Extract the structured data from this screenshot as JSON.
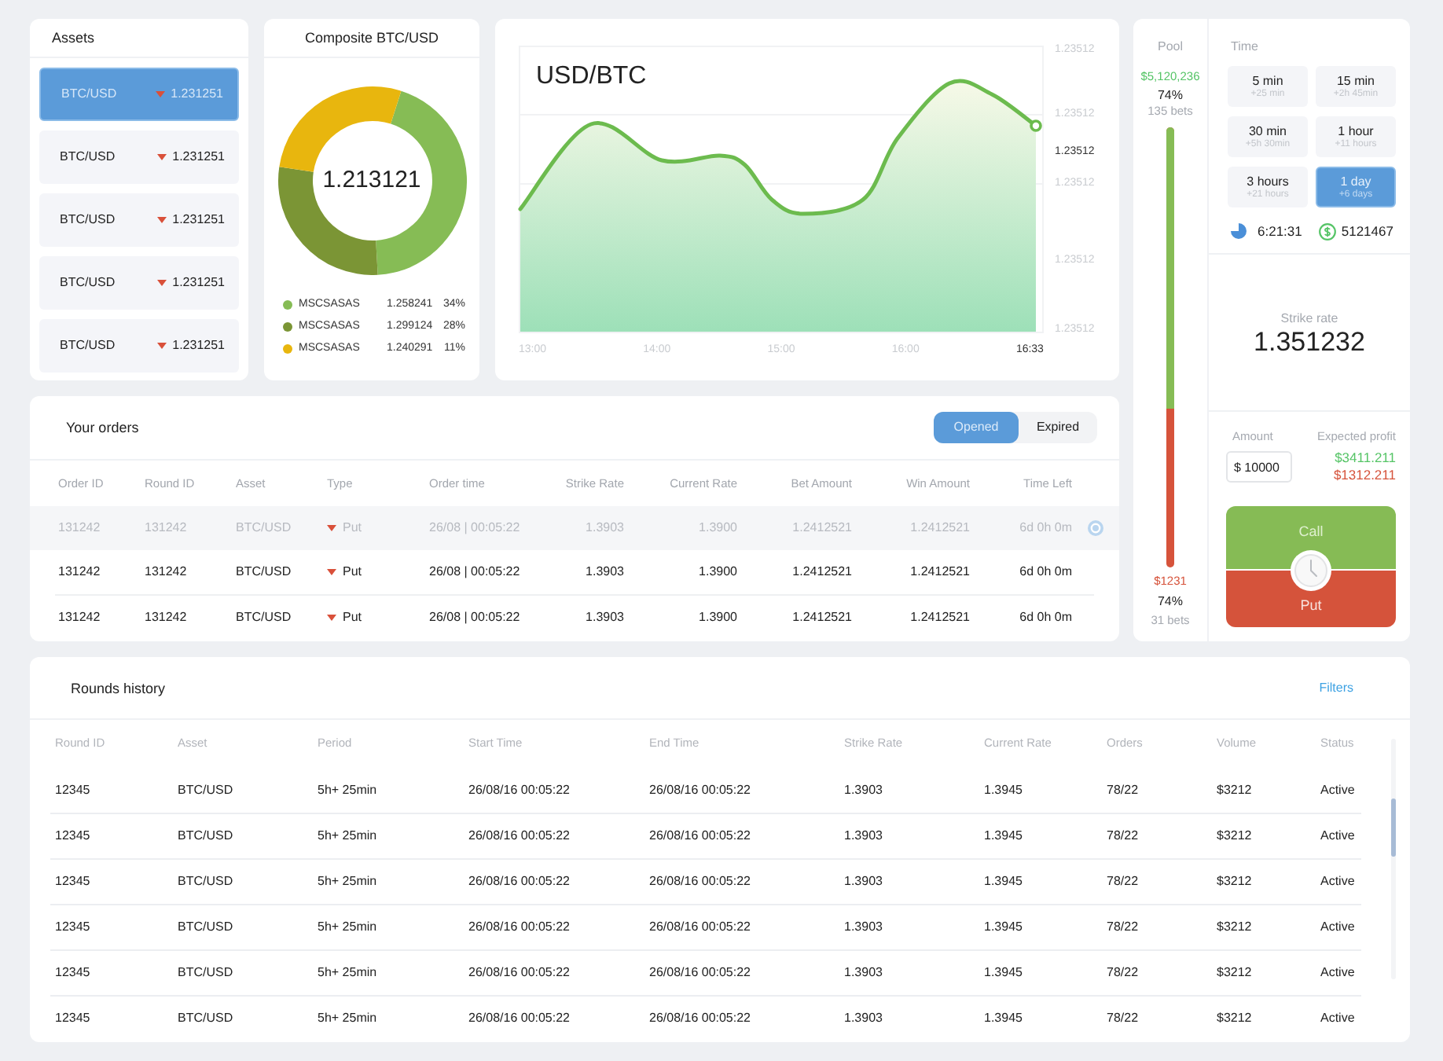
{
  "assets": {
    "title": "Assets",
    "items": [
      {
        "pair": "BTC/USD",
        "falling": true,
        "price": "1.231251",
        "selected": true
      },
      {
        "pair": "BTC/USD",
        "falling": true,
        "price": "1.231251",
        "selected": false
      },
      {
        "pair": "BTC/USD",
        "falling": true,
        "price": "1.231251",
        "selected": false
      },
      {
        "pair": "BTC/USD",
        "falling": true,
        "price": "1.231251",
        "selected": false
      },
      {
        "pair": "BTC/USD",
        "falling": true,
        "price": "1.231251",
        "selected": false
      }
    ]
  },
  "composite": {
    "title": "Composite BTC/USD",
    "center_value": "1.213121",
    "legend": [
      {
        "name": "MSCSASAS",
        "value": "1.258241",
        "share": "34%",
        "color": "#86bc55"
      },
      {
        "name": "MSCSASAS",
        "value": "1.299124",
        "share": "28%",
        "color": "#7b9535"
      },
      {
        "name": "MSCSASAS",
        "value": "1.240291",
        "share": "11%",
        "color": "#e8b60e"
      }
    ]
  },
  "price_chart": {
    "title": "USD/BTC",
    "y_labels": [
      {
        "text": "1.23512",
        "current": false
      },
      {
        "text": "1.23512",
        "current": false
      },
      {
        "text": "1.23512",
        "current": true
      },
      {
        "text": "1.23512",
        "current": false
      },
      {
        "text": "1.23512",
        "current": false
      },
      {
        "text": "1.23512",
        "current": false
      }
    ],
    "x_labels": [
      {
        "text": "13:00",
        "current": false
      },
      {
        "text": "14:00",
        "current": false
      },
      {
        "text": "15:00",
        "current": false
      },
      {
        "text": "16:00",
        "current": false
      },
      {
        "text": "16:33",
        "current": true
      }
    ]
  },
  "orders": {
    "title": "Your orders",
    "filters": [
      {
        "label": "Opened",
        "selected": true
      },
      {
        "label": "Expired",
        "selected": false
      }
    ],
    "columns": [
      "Order ID",
      "Round ID",
      "Asset",
      "Type",
      "Order time",
      "Strike Rate",
      "Current Rate",
      "Bet Amount",
      "Win Amount",
      "Time Left"
    ],
    "rows": [
      {
        "pending": true,
        "falling": true,
        "cells": [
          "131242",
          "131242",
          "BTC/USD",
          "Put",
          "26/08 | 00:05:22",
          "1.3903",
          "1.3900",
          "1.2412521",
          "1.2412521",
          "6d 0h 0m"
        ]
      },
      {
        "pending": false,
        "falling": true,
        "cells": [
          "131242",
          "131242",
          "BTC/USD",
          "Put",
          "26/08 | 00:05:22",
          "1.3903",
          "1.3900",
          "1.2412521",
          "1.2412521",
          "6d 0h 0m"
        ]
      },
      {
        "pending": false,
        "falling": true,
        "cells": [
          "131242",
          "131242",
          "BTC/USD",
          "Put",
          "26/08 | 00:05:22",
          "1.3903",
          "1.3900",
          "1.2412521",
          "1.2412521",
          "6d 0h 0m"
        ]
      }
    ]
  },
  "pool": {
    "title": "Pool",
    "call": {
      "amount": "$5,120,236",
      "share": "74%",
      "bets": "135 bets"
    },
    "put": {
      "amount": "$1231",
      "share": "74%",
      "bets": "31 bets"
    },
    "level": 0.64
  },
  "time": {
    "title": "Time",
    "options": [
      {
        "label": "5 min",
        "sub": "+25 min",
        "selected": false
      },
      {
        "label": "15 min",
        "sub": "+2h 45min",
        "selected": false
      },
      {
        "label": "30 min",
        "sub": "+5h 30min",
        "selected": false
      },
      {
        "label": "1 hour",
        "sub": "+11 hours",
        "selected": false
      },
      {
        "label": "3 hours",
        "sub": "+21 hours",
        "selected": false
      },
      {
        "label": "1 day",
        "sub": "+6 days",
        "selected": true
      }
    ],
    "countdown": "6:21:31",
    "count": "5121467"
  },
  "strike": {
    "label": "Strike rate",
    "value": "1.351232"
  },
  "trade": {
    "amount_label": "Amount",
    "amount": "$ 10000",
    "profit_label": "Expected profit",
    "profit_call": "$3411.211",
    "profit_put": "$1312.211",
    "call_label": "Call",
    "put_label": "Put"
  },
  "rounds": {
    "title": "Rounds history",
    "filters_label": "Filters",
    "columns": [
      "Round ID",
      "Asset",
      "Period",
      "Start Time",
      "End Time",
      "Strike Rate",
      "Current Rate",
      "Orders",
      "Volume",
      "Status"
    ],
    "rows": [
      [
        "12345",
        "BTC/USD",
        "5h+ 25min",
        "26/08/16 00:05:22",
        "26/08/16 00:05:22",
        "1.3903",
        "1.3945",
        "78/22",
        "$3212",
        "Active"
      ],
      [
        "12345",
        "BTC/USD",
        "5h+ 25min",
        "26/08/16 00:05:22",
        "26/08/16 00:05:22",
        "1.3903",
        "1.3945",
        "78/22",
        "$3212",
        "Active"
      ],
      [
        "12345",
        "BTC/USD",
        "5h+ 25min",
        "26/08/16 00:05:22",
        "26/08/16 00:05:22",
        "1.3903",
        "1.3945",
        "78/22",
        "$3212",
        "Active"
      ],
      [
        "12345",
        "BTC/USD",
        "5h+ 25min",
        "26/08/16 00:05:22",
        "26/08/16 00:05:22",
        "1.3903",
        "1.3945",
        "78/22",
        "$3212",
        "Active"
      ],
      [
        "12345",
        "BTC/USD",
        "5h+ 25min",
        "26/08/16 00:05:22",
        "26/08/16 00:05:22",
        "1.3903",
        "1.3945",
        "78/22",
        "$3212",
        "Active"
      ],
      [
        "12345",
        "BTC/USD",
        "5h+ 25min",
        "26/08/16 00:05:22",
        "26/08/16 00:05:22",
        "1.3903",
        "1.3945",
        "78/22",
        "$3212",
        "Active"
      ]
    ]
  }
}
